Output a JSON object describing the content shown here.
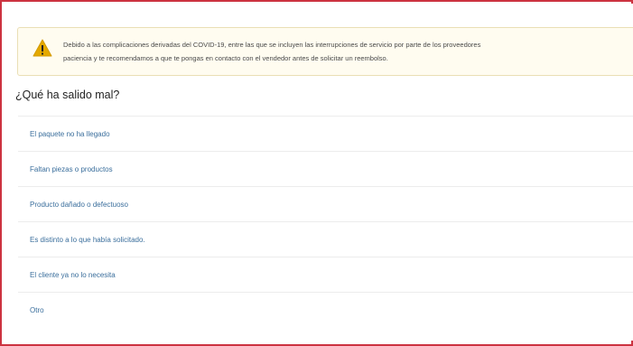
{
  "alert": {
    "icon": "warning-icon",
    "line1": "Debido a las complicaciones derivadas del COVID-19, entre las que se incluyen las interrupciones de servicio por parte de los proveedores",
    "line2": "paciencia y te recomendamos a que te pongas en contacto con el vendedor antes de solicitar un reembolso."
  },
  "section_title": "¿Qué ha salido mal?",
  "options": [
    {
      "label": "El paquete no ha llegado"
    },
    {
      "label": "Faltan piezas o productos"
    },
    {
      "label": "Producto dañado o defectuoso"
    },
    {
      "label": "Es distinto a lo que había solicitado."
    },
    {
      "label": "El cliente ya no lo necesita"
    },
    {
      "label": "Otro"
    }
  ],
  "colors": {
    "frame_border": "#cc3340",
    "alert_background": "#fffcf0",
    "warning_icon": "#e4a900",
    "link": "#3a6e9c"
  }
}
